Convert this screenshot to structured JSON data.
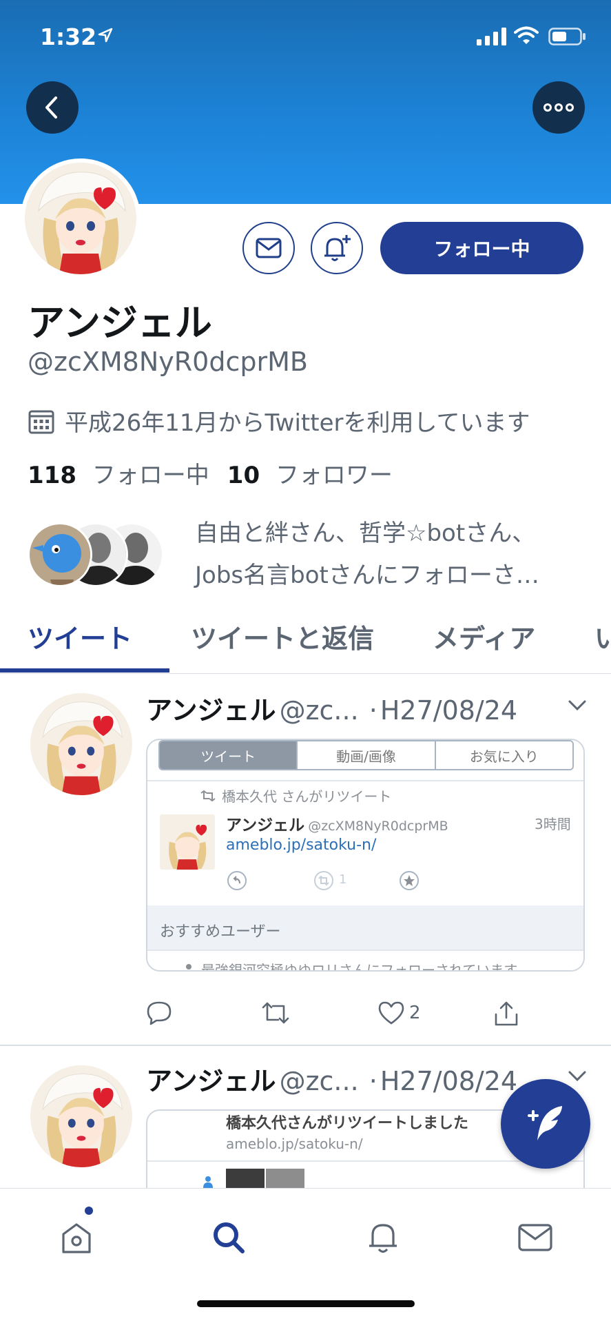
{
  "status_bar": {
    "time": "1:32"
  },
  "profile": {
    "display_name": "アンジェル",
    "handle": "@zcXM8NyR0dcprMB",
    "joined": "平成26年11月からTwitterを利用しています",
    "following_count": "118",
    "following_label": "フォロー中",
    "followers_count": "10",
    "followers_label": "フォロワー",
    "followed_by_line1": "自由と絆さん、哲学☆botさん、",
    "followed_by_line2": "Jobs名言botさんにフォローさ…",
    "following_button": "フォロー中"
  },
  "tabs": [
    {
      "label": "ツイート"
    },
    {
      "label": "ツイートと返信"
    },
    {
      "label": "メディア"
    },
    {
      "label": "い"
    }
  ],
  "tweets": [
    {
      "name": "アンジェル",
      "handle": "@zc...",
      "dot": "·",
      "date": "H27/08/24",
      "embed": {
        "tabs": [
          "ツイート",
          "動画/画像",
          "お気に入り"
        ],
        "retweet_line": "橋本久代 さんがリツイート",
        "inner_name": "アンジェル",
        "inner_handle": "@zcXM8NyR0dcprMB",
        "inner_time": "3時間",
        "inner_link": "ameblo.jp/satoku-n/",
        "inner_retweets": "1",
        "section_title": "おすすめユーザー",
        "bottom_text": "最強銀河究極ゆゆロリさんにフォローされています"
      },
      "likes": "2"
    },
    {
      "name": "アンジェル",
      "handle": "@zc...",
      "dot": "·",
      "date": "H27/08/24",
      "embed": {
        "retweet_text": "橋本久代さんがリツイートしました",
        "link": "ameblo.jp/satoku-n/"
      }
    }
  ],
  "icons": {
    "back": "back-arrow-icon",
    "more": "more-icon",
    "dm": "mail-icon",
    "notify": "bell-plus-icon",
    "calendar": "calendar-icon",
    "compose": "compose-icon",
    "home": "home-icon",
    "search": "search-icon",
    "notifications": "bell-icon",
    "messages": "mail-icon"
  },
  "colors": {
    "accent": "#223f95",
    "banner": "#1d84d8",
    "muted": "#5b6672"
  }
}
